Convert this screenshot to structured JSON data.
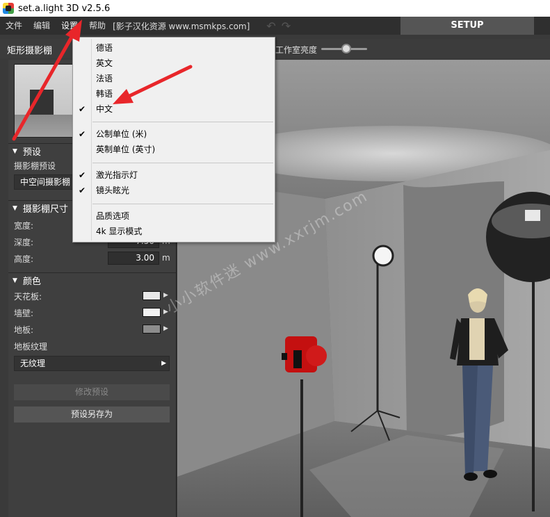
{
  "window": {
    "title": "set.a.light 3D v2.5.6"
  },
  "menubar": {
    "items": [
      "文件",
      "编辑",
      "设置",
      "帮助"
    ],
    "note": "[影子汉化资源 www.msmkps.com]",
    "setup_tab": "SETUP"
  },
  "toolbar": {
    "panel_title": "矩形摄影棚",
    "brightness_label": "工作室亮度",
    "brightness_level": 0.55
  },
  "left_panel": {
    "preset_section": "预设",
    "studio_preset_label": "摄影棚预设",
    "studio_preset_value": "中空间摄影棚",
    "size_section": "摄影棚尺寸",
    "width_label": "宽度:",
    "depth_label": "深度:",
    "depth_value": "7.50",
    "height_label": "高度:",
    "height_value": "3.00",
    "unit": "m",
    "color_section": "颜色",
    "ceiling_label": "天花板:",
    "wall_label": "墙壁:",
    "floor_label": "地板:",
    "ceiling_color": "#e8e8e8",
    "wall_color": "#f2f2f2",
    "floor_color": "#8c8c8c",
    "texture_label": "地板纹理",
    "texture_value": "无纹理",
    "modify_button": "修改预设",
    "save_as_button": "预设另存为"
  },
  "settings_menu": {
    "languages": [
      {
        "label": "德语",
        "checked": false
      },
      {
        "label": "英文",
        "checked": false
      },
      {
        "label": "法语",
        "checked": false
      },
      {
        "label": "韩语",
        "checked": false
      },
      {
        "label": "中文",
        "checked": true
      }
    ],
    "units": [
      {
        "label": "公制单位 (米)",
        "checked": true
      },
      {
        "label": "英制单位 (英寸)",
        "checked": false
      }
    ],
    "toggles": [
      {
        "label": "激光指示灯",
        "checked": true
      },
      {
        "label": "镜头眩光",
        "checked": true
      }
    ],
    "quality": [
      {
        "label": "品质选项",
        "checked": false
      },
      {
        "label": "4k 显示模式",
        "checked": false
      }
    ]
  },
  "viewport": {
    "watermark": "小小软件迷 www.xxrjm.com"
  },
  "colors": {
    "arrow": "#e8262a",
    "camera": "#c41010"
  }
}
